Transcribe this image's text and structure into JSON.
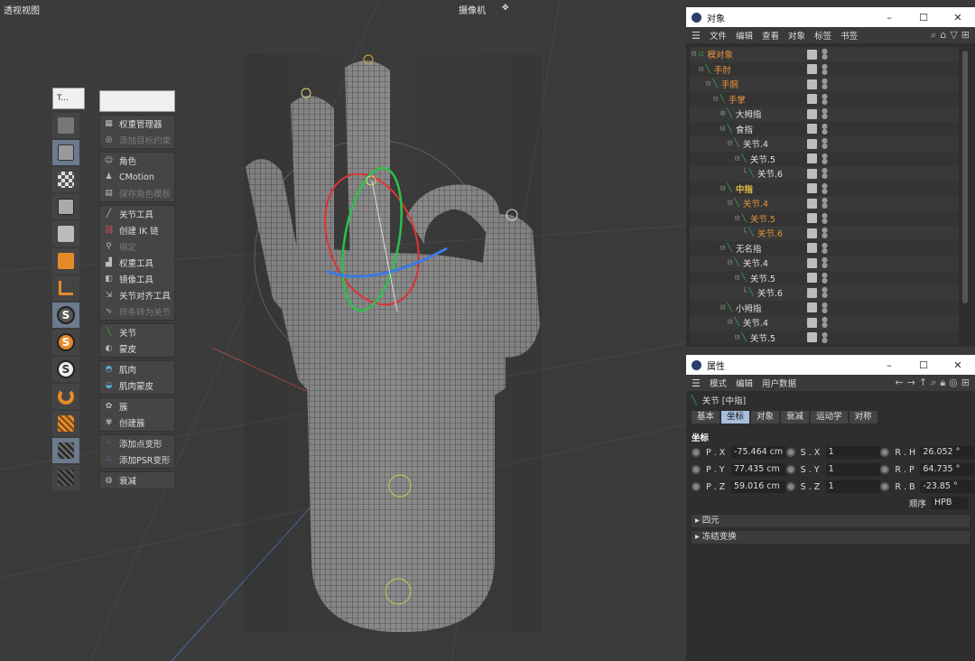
{
  "viewport": {
    "title": "透视视图",
    "camera": "摄像机"
  },
  "palette": {
    "top_a": "T...",
    "menu_groups": [
      [
        {
          "label": "权重管理器",
          "enabled": true,
          "icon": "weight-manager-icon"
        },
        {
          "label": "添加目标约束",
          "enabled": false,
          "icon": "target-constraint-icon"
        }
      ],
      [
        {
          "label": "角色",
          "enabled": true,
          "icon": "character-icon"
        },
        {
          "label": "CMotion",
          "enabled": true,
          "icon": "cmotion-icon"
        },
        {
          "label": "保存角色模板",
          "enabled": false,
          "icon": "save-template-icon"
        }
      ],
      [
        {
          "label": "关节工具",
          "enabled": true,
          "icon": "joint-tool-icon"
        },
        {
          "label": "创建 IK 链",
          "enabled": true,
          "icon": "ik-chain-icon"
        },
        {
          "label": "绑定",
          "enabled": false,
          "icon": "bind-icon"
        },
        {
          "label": "权重工具",
          "enabled": true,
          "icon": "weight-tool-icon"
        },
        {
          "label": "镜像工具",
          "enabled": true,
          "icon": "mirror-tool-icon"
        },
        {
          "label": "关节对齐工具",
          "enabled": true,
          "icon": "joint-align-icon"
        },
        {
          "label": "样条转为关节",
          "enabled": false,
          "icon": "spline-to-joint-icon"
        }
      ],
      [
        {
          "label": "关节",
          "enabled": true,
          "icon": "joint-icon"
        },
        {
          "label": "蒙皮",
          "enabled": true,
          "icon": "skin-icon"
        }
      ],
      [
        {
          "label": "肌肉",
          "enabled": true,
          "icon": "muscle-icon"
        },
        {
          "label": "肌肉蒙皮",
          "enabled": true,
          "icon": "muscle-skin-icon"
        }
      ],
      [
        {
          "label": "簇",
          "enabled": true,
          "icon": "cluster-icon"
        },
        {
          "label": "创建簇",
          "enabled": true,
          "icon": "create-cluster-icon"
        }
      ],
      [
        {
          "label": "添加点变形",
          "enabled": true,
          "icon": "point-morph-icon"
        },
        {
          "label": "添加PSR变形",
          "enabled": true,
          "icon": "psr-morph-icon"
        }
      ],
      [
        {
          "label": "衰减",
          "enabled": true,
          "icon": "falloff-icon"
        }
      ]
    ]
  },
  "objects_window": {
    "title": "对象",
    "menu": [
      "文件",
      "编辑",
      "查看",
      "对象",
      "标签",
      "书签"
    ],
    "rows": [
      {
        "label": "模对象",
        "depth": 0,
        "style": "orange",
        "tree": "⊟"
      },
      {
        "label": "手肘",
        "depth": 1,
        "style": "orange",
        "tree": "⊟"
      },
      {
        "label": "手腕",
        "depth": 2,
        "style": "orange",
        "tree": "⊟"
      },
      {
        "label": "手掌",
        "depth": 3,
        "style": "orange",
        "tree": "⊟"
      },
      {
        "label": "大拇指",
        "depth": 4,
        "style": "normal",
        "tree": "⊞"
      },
      {
        "label": "食指",
        "depth": 4,
        "style": "normal",
        "tree": "⊟"
      },
      {
        "label": "关节.4",
        "depth": 5,
        "style": "normal",
        "tree": "⊟"
      },
      {
        "label": "关节.5",
        "depth": 6,
        "style": "normal",
        "tree": "⊟"
      },
      {
        "label": "关节.6",
        "depth": 7,
        "style": "normal",
        "tree": "└"
      },
      {
        "label": "中指",
        "depth": 4,
        "style": "yellow",
        "tree": "⊟"
      },
      {
        "label": "关节.4",
        "depth": 5,
        "style": "orange",
        "tree": "⊟"
      },
      {
        "label": "关节.5",
        "depth": 6,
        "style": "orange",
        "tree": "⊟"
      },
      {
        "label": "关节.6",
        "depth": 7,
        "style": "orange",
        "tree": "└"
      },
      {
        "label": "无名指",
        "depth": 4,
        "style": "normal",
        "tree": "⊟"
      },
      {
        "label": "关节.4",
        "depth": 5,
        "style": "normal",
        "tree": "⊟"
      },
      {
        "label": "关节.5",
        "depth": 6,
        "style": "normal",
        "tree": "⊟"
      },
      {
        "label": "关节.6",
        "depth": 7,
        "style": "normal",
        "tree": "└"
      },
      {
        "label": "小拇指",
        "depth": 4,
        "style": "normal",
        "tree": "⊟"
      },
      {
        "label": "关节.4",
        "depth": 5,
        "style": "normal",
        "tree": "⊟"
      },
      {
        "label": "关节.5",
        "depth": 6,
        "style": "normal",
        "tree": "⊟"
      }
    ]
  },
  "attributes_window": {
    "title": "属性",
    "menu": [
      "模式",
      "编辑",
      "用户数据"
    ],
    "object_title": "关节 [中指]",
    "tabs": [
      "基本",
      "坐标",
      "对象",
      "衰减",
      "运动学",
      "对称"
    ],
    "active_tab": 1,
    "section": "坐标",
    "coords": [
      [
        {
          "label": "P . X",
          "value": "-75.464 cm"
        },
        {
          "label": "S . X",
          "value": "1"
        },
        {
          "label": "R . H",
          "value": "26.052 °"
        }
      ],
      [
        {
          "label": "P . Y",
          "value": "77.435 cm"
        },
        {
          "label": "S . Y",
          "value": "1"
        },
        {
          "label": "R . P",
          "value": "64.735 °"
        }
      ],
      [
        {
          "label": "P . Z",
          "value": "59.016 cm"
        },
        {
          "label": "S . Z",
          "value": "1"
        },
        {
          "label": "R . B",
          "value": "-23.85 °"
        }
      ]
    ],
    "order_label": "顺序",
    "order_value": "HPB",
    "collapsed": [
      "四元",
      "冻结变换"
    ]
  }
}
